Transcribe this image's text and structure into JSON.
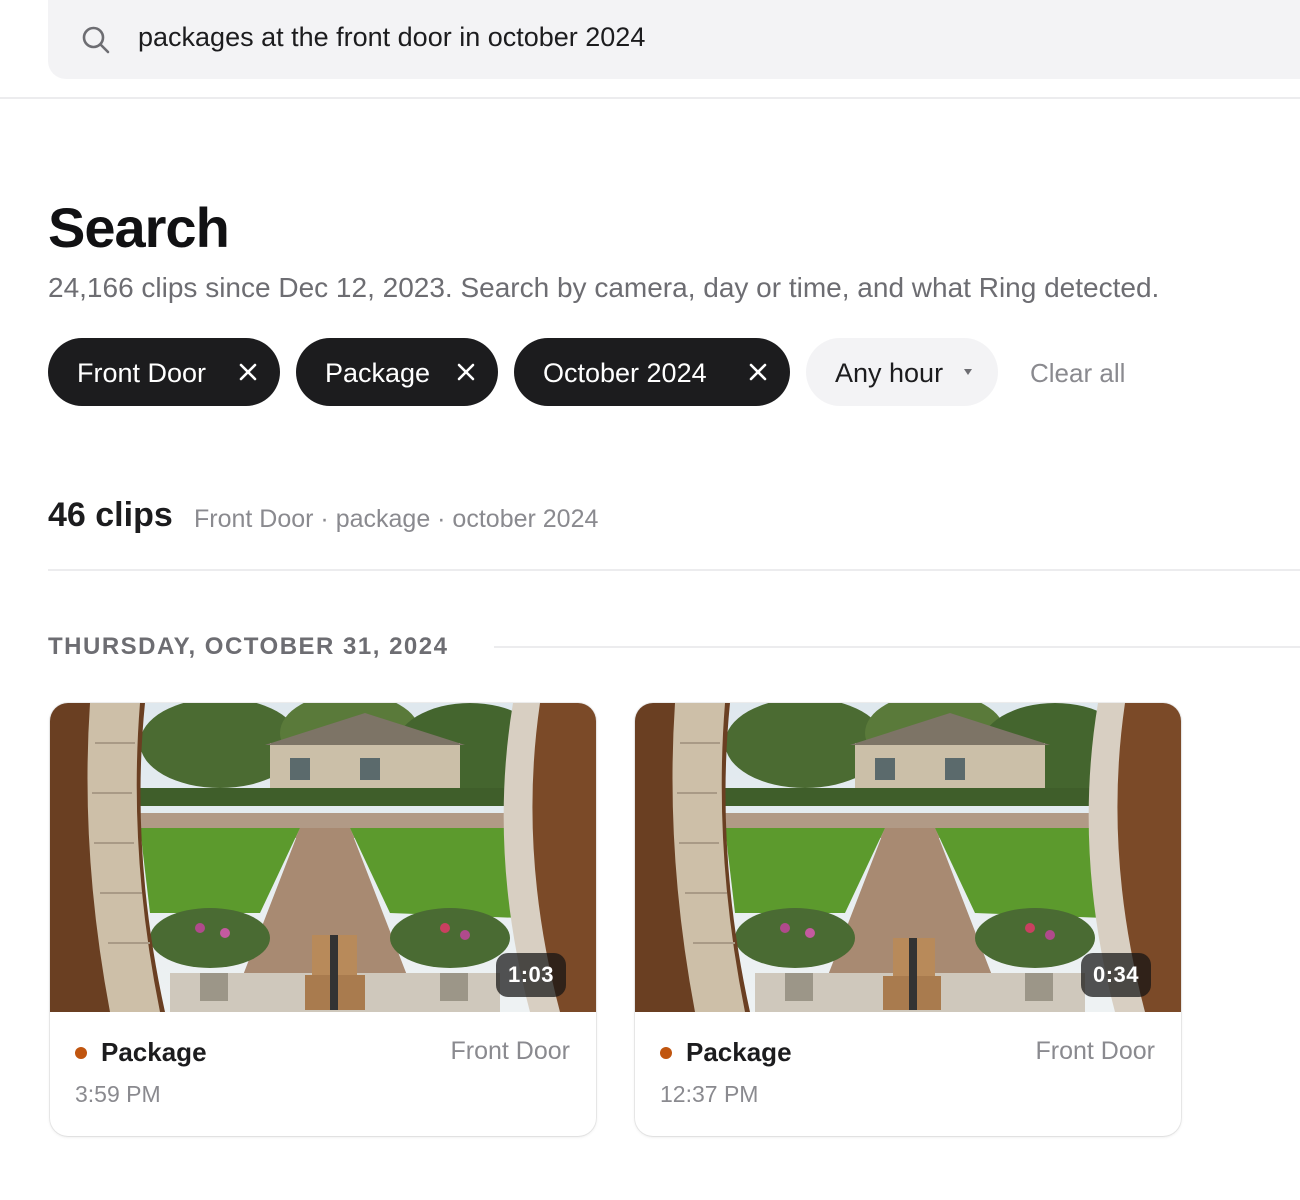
{
  "search": {
    "query": "packages at the front door in october 2024"
  },
  "header": {
    "title": "Search",
    "subtitle": "24,166 clips since Dec 12, 2023. Search by camera, day or time, and what Ring detected."
  },
  "filters": {
    "chips": [
      {
        "label": "Front Door"
      },
      {
        "label": "Package"
      },
      {
        "label": "October 2024"
      }
    ],
    "hour_dropdown": {
      "label": "Any hour"
    },
    "clear_all": "Clear all"
  },
  "results": {
    "count": "46 clips",
    "summary": "Front Door · package · october 2024"
  },
  "groups": [
    {
      "date": "THURSDAY, OCTOBER 31, 2024",
      "clips": [
        {
          "duration": "1:03",
          "event": "Package",
          "camera": "Front Door",
          "time": "3:59 PM"
        },
        {
          "duration": "0:34",
          "event": "Package",
          "camera": "Front Door",
          "time": "12:37 PM"
        }
      ]
    }
  ],
  "colors": {
    "chip_active_bg": "#1c1c1e",
    "event_dot": "#c0550f",
    "search_bg": "#f3f3f5"
  },
  "icons": [
    "search-icon",
    "close-icon",
    "caret-down-icon"
  ]
}
